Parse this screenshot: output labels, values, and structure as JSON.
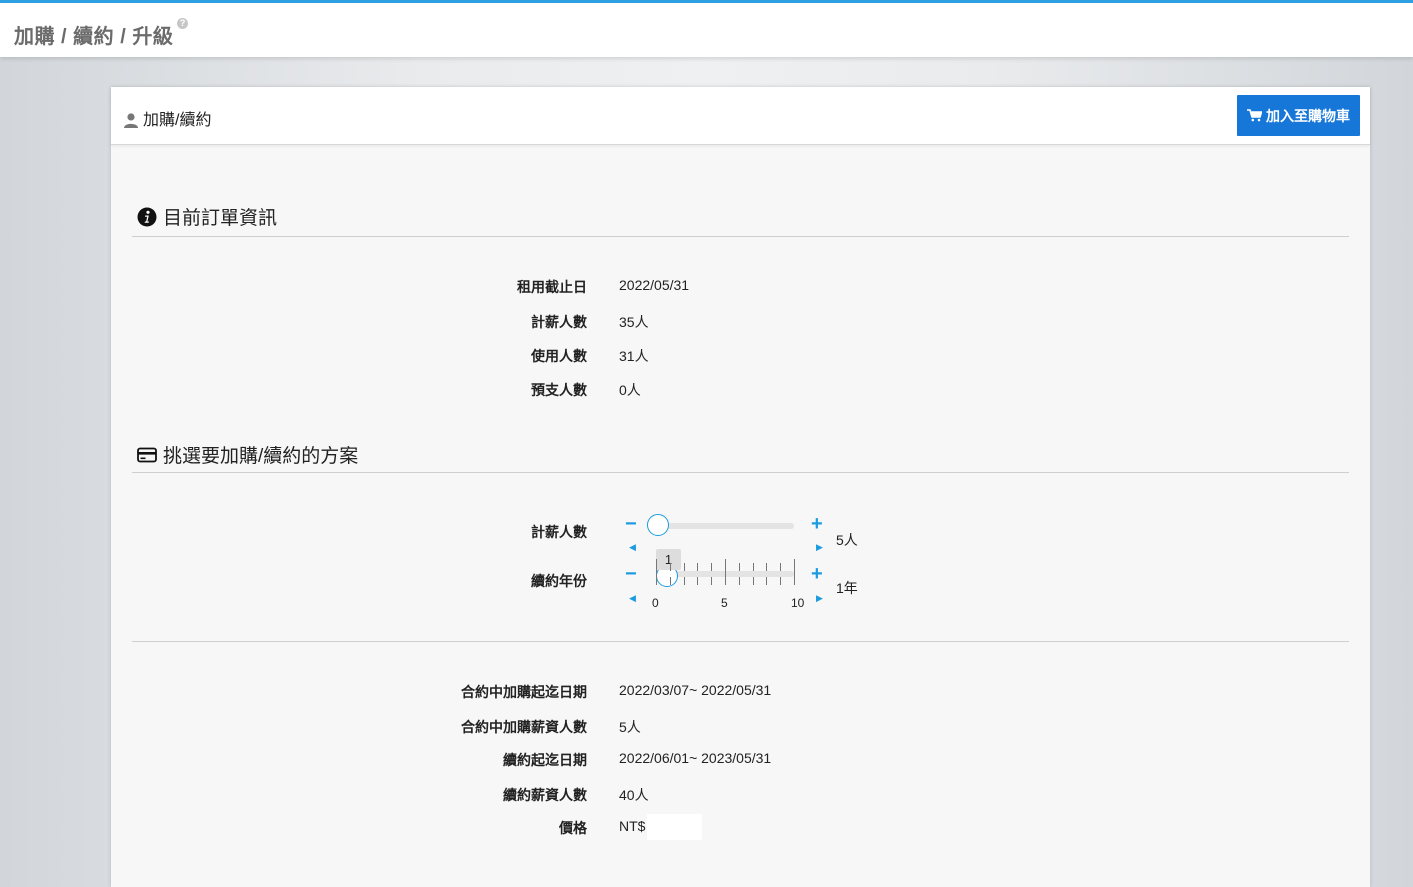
{
  "topbar": {
    "title": "加購 / 續約 / 升級",
    "help_icon": "?"
  },
  "card": {
    "title": "加購/續約",
    "cart_button": "加入至購物車"
  },
  "current_order": {
    "heading": "目前訂單資訊",
    "rows": [
      {
        "label": "租用截止日",
        "value": "2022/05/31"
      },
      {
        "label": "計薪人數",
        "value": "35人"
      },
      {
        "label": "使用人數",
        "value": "31人"
      },
      {
        "label": "預支人數",
        "value": "0人"
      }
    ]
  },
  "plan": {
    "heading": "挑選要加購/續約的方案",
    "headcount": {
      "label": "計薪人數",
      "value": "5人",
      "minus": "−",
      "plus": "+",
      "slider_value": 5
    },
    "years": {
      "label": "續約年份",
      "value": "1年",
      "minus": "−",
      "plus": "+",
      "tooltip": "1",
      "slider_value": 1,
      "min": 0,
      "max": 10,
      "tick_labels": [
        "0",
        "5",
        "10"
      ]
    }
  },
  "summary": {
    "rows": [
      {
        "label": "合約中加購起迄日期",
        "value": "2022/03/07~ 2022/05/31"
      },
      {
        "label": "合約中加購薪資人數",
        "value": "5人"
      },
      {
        "label": "續約起迄日期",
        "value": "2022/06/01~ 2023/05/31"
      },
      {
        "label": "續約薪資人數",
        "value": "40人"
      },
      {
        "label": "價格",
        "value": "NT$"
      }
    ]
  },
  "colors": {
    "accent": "#1b9be0",
    "button": "#1677d9",
    "topbar_border": "#2e9fe0"
  }
}
